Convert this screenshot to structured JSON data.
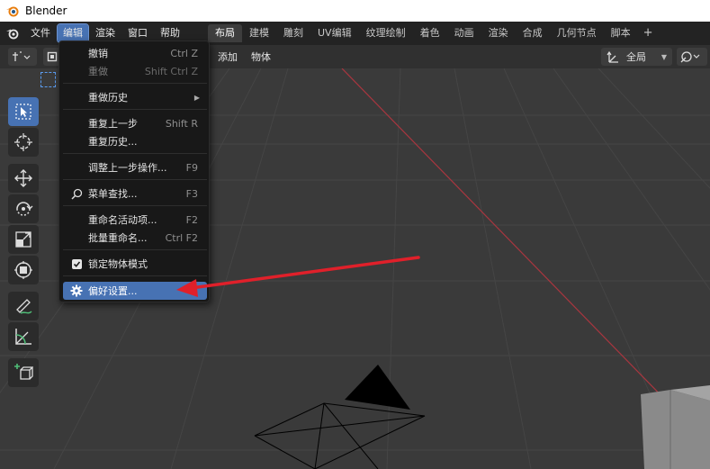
{
  "window": {
    "title": "Blender"
  },
  "topbar": {
    "menus": [
      "文件",
      "编辑",
      "渲染",
      "窗口",
      "帮助"
    ],
    "active_menu_index": 1,
    "workspaces": [
      "布局",
      "建模",
      "雕刻",
      "UV编辑",
      "纹理绘制",
      "着色",
      "动画",
      "渲染",
      "合成",
      "几何节点",
      "脚本"
    ],
    "active_workspace_index": 0,
    "add_workspace": "+"
  },
  "viewport_header": {
    "add_menu": "添加",
    "object_menu": "物体",
    "orientation": "全局"
  },
  "edit_menu": {
    "undo": {
      "label": "撤销",
      "shortcut": "Ctrl Z"
    },
    "redo": {
      "label": "重做",
      "shortcut": "Shift Ctrl Z"
    },
    "undo_history": {
      "label": "重做历史"
    },
    "repeat_last": {
      "label": "重复上一步",
      "shortcut": "Shift R"
    },
    "repeat_history": {
      "label": "重复历史..."
    },
    "adjust_last": {
      "label": "调整上一步操作...",
      "shortcut": "F9"
    },
    "menu_search": {
      "label": "菜单查找...",
      "shortcut": "F3"
    },
    "rename_active": {
      "label": "重命名活动项...",
      "shortcut": "F2"
    },
    "batch_rename": {
      "label": "批量重命名...",
      "shortcut": "Ctrl F2"
    },
    "lock_object_modes": {
      "label": "锁定物体模式",
      "checked": true
    },
    "preferences": {
      "label": "偏好设置..."
    }
  },
  "colors": {
    "accent": "#4772b3",
    "annotation_arrow": "#e0202a",
    "x_axis": "#a8363f"
  },
  "icons": [
    "blender-logo-icon",
    "select-box-icon",
    "cursor-icon",
    "move-icon",
    "rotate-icon",
    "scale-icon",
    "transform-icon",
    "annotate-icon",
    "measure-icon",
    "add-cube-icon",
    "search-icon",
    "gear-icon",
    "checkbox-icon"
  ]
}
